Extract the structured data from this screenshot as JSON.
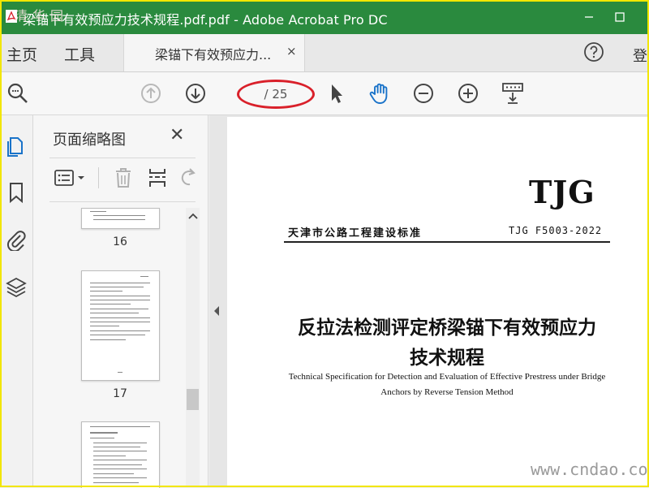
{
  "window": {
    "title": "梁锚下有效预应力技术规程.pdf.pdf - Adobe Acrobat Pro DC",
    "watermark_overlay": "清华园",
    "icons": {
      "app": "acrobat-icon",
      "minimize": "minimize-icon",
      "maximize": "maximize-icon"
    }
  },
  "menubar": {
    "home": "主页",
    "tools": "工具",
    "tab_label": "梁锚下有效预应力...",
    "tab_close": "×",
    "signin": "登"
  },
  "toolbar": {
    "page_indicator": "/ 25",
    "icons": [
      "search-zoom-icon",
      "page-up-icon",
      "page-down-icon",
      "select-cursor-icon",
      "hand-tool-icon",
      "zoom-out-icon",
      "zoom-in-icon",
      "read-mode-icon"
    ]
  },
  "thumbnails": {
    "title": "页面缩略图",
    "close": "✕",
    "pages": [
      {
        "number": "16"
      },
      {
        "number": "17"
      }
    ]
  },
  "document": {
    "logo": "TJG",
    "standard_line": "天津市公路工程建设标准",
    "standard_number": "TJG F5003-2022",
    "title_line1": "反拉法检测评定桥梁锚下有效预应力",
    "title_line2": "技术规程",
    "english_line1": "Technical Specification for Detection and Evaluation of Effective Prestress under Bridge",
    "english_line2": "Anchors by Reverse Tension Method"
  },
  "site_watermark": "www.cndao.com",
  "colors": {
    "titlebar": "#2a8a3e",
    "frame": "#f2e600",
    "annotation": "#d9202a",
    "accent": "#1a73c9"
  }
}
